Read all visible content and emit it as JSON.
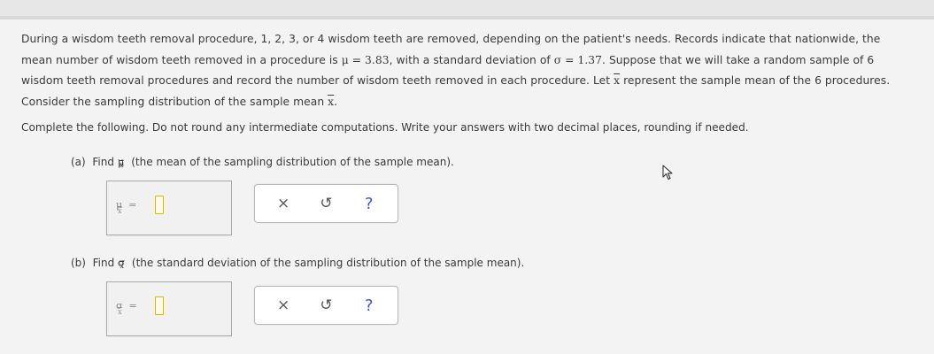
{
  "intro": {
    "p1": "During a wisdom teeth removal procedure, 1, 2, 3, or 4 wisdom teeth are removed, depending on the patient's needs. Records indicate that nationwide, the",
    "p2a": "mean number of wisdom teeth removed in a procedure is ",
    "mu_eq": "μ = 3.83",
    "p2b": ", with a standard deviation of ",
    "sigma_eq": "σ = 1.37",
    "p2c": ". Suppose that we will take a random sample of 6",
    "p3a": "wisdom teeth removal procedures and record the number of wisdom teeth removed in each procedure. Let ",
    "x_sym": "x",
    "p3b": " represent the sample mean of the 6 procedures.",
    "p4a": "Consider the sampling distribution of the sample mean ",
    "p4b": "."
  },
  "instructions": "Complete the following. Do not round any intermediate computations. Write your answers with two decimal places, rounding if needed.",
  "part_a": {
    "label": "(a)",
    "find": "Find",
    "symbol": "μ",
    "sub": "x",
    "desc": "(the mean of the sampling distribution of the sample mean).",
    "answer_label": "μ",
    "answer_eq": "=",
    "value": ""
  },
  "part_b": {
    "label": "(b)",
    "find": "Find",
    "symbol": "σ",
    "sub": "x",
    "desc": "(the standard deviation of the sampling distribution of the sample mean).",
    "answer_label": "σ",
    "answer_eq": "=",
    "value": ""
  },
  "tools": {
    "clear": "×",
    "undo": "↺",
    "help": "?"
  }
}
